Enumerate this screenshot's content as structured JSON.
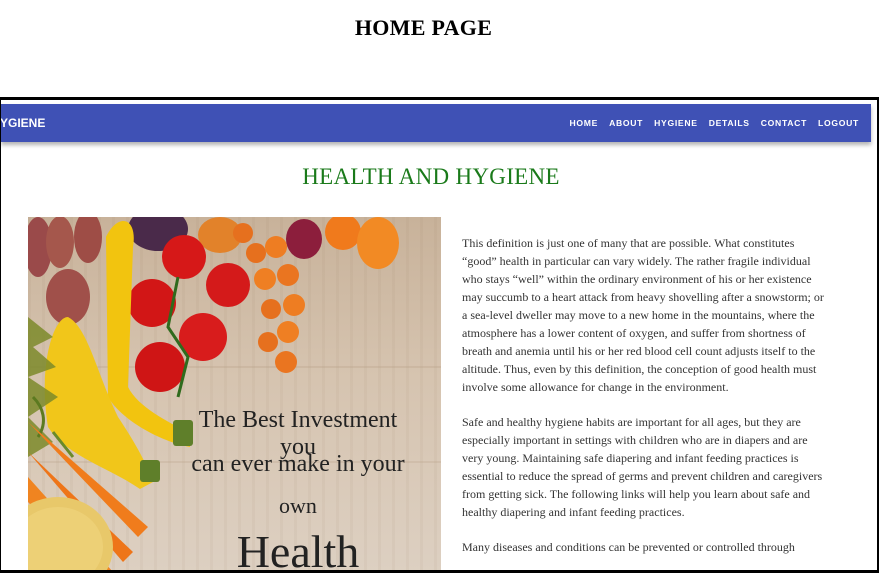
{
  "doc_title": "HOME PAGE",
  "navbar": {
    "brand": "YGIENE",
    "links": [
      "HOME",
      "ABOUT",
      "HYGIENE",
      "DETAILS",
      "CONTACT",
      "LOGOUT"
    ],
    "color": "#3f51b5"
  },
  "main": {
    "heading": "HEALTH AND HYGIENE",
    "heading_color": "#1a7a1a",
    "hero": {
      "lines": [
        "The Best Investment you",
        "can ever make in your",
        "own",
        "Health"
      ]
    },
    "paragraphs": [
      "This definition is just one of many that are possible. What constitutes “good” health in particular can vary widely. The rather fragile individual who stays “well” within the ordinary environment of his or her existence may succumb to a heart attack from heavy shovelling after a snowstorm; or a sea-level dweller may move to a new home in the mountains, where the atmosphere has a lower content of oxygen, and suffer from shortness of breath and anemia until his or her red blood cell count adjusts itself to the altitude. Thus, even by this definition, the conception of good health must involve some allowance for change in the environment.",
      "Safe and healthy hygiene habits are important for all ages, but they are especially important in settings with children who are in diapers and are very young. Maintaining safe diapering and infant feeding practices is essential to reduce the spread of germs and prevent children and caregivers from getting sick. The following links will help you learn about safe and healthy diapering and infant feeding practices.",
      "Many diseases and conditions can be prevented or controlled through"
    ]
  }
}
